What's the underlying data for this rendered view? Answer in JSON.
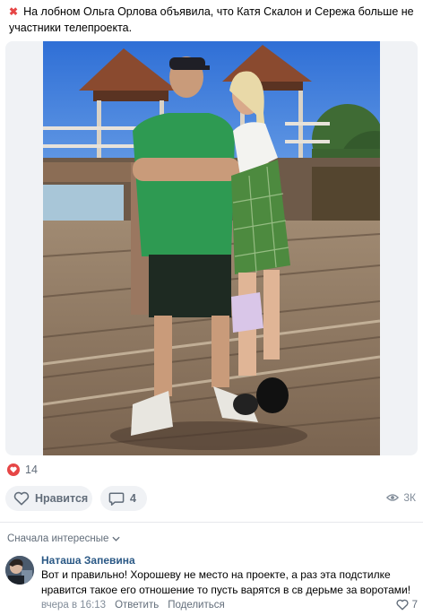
{
  "post": {
    "marker": "✖",
    "text": "На лобном Ольга Орлова объявила, что Катя Скалон и Сережа больше не участники телепроекта."
  },
  "reactions": {
    "likes_count": "14"
  },
  "actions": {
    "like_label": "Нравится",
    "comments_count": "4",
    "views_count": "3К"
  },
  "comments": {
    "sort_label": "Сначала интересные",
    "items": [
      {
        "author": "Наташа Запевина",
        "text": "Вот и правильно! Хорошеву не место на проекте, а раз эта подстилке нравится такое его отношение то пусть варятся в св дерьме за воротами!",
        "time": "вчера в 16:13",
        "reply_label": "Ответить",
        "share_label": "Поделиться",
        "likes": "7"
      }
    ]
  },
  "colors": {
    "accent_red": "#e64646",
    "link_blue": "#2a5885",
    "muted": "#626d7a",
    "button_bg": "#f0f2f5"
  },
  "icons": {
    "post_marker": "cross-mark-icon",
    "reaction": "heart-icon",
    "like": "heart-outline-icon",
    "comment": "speech-bubble-icon",
    "views": "eye-icon",
    "sort": "chevron-down-icon"
  }
}
